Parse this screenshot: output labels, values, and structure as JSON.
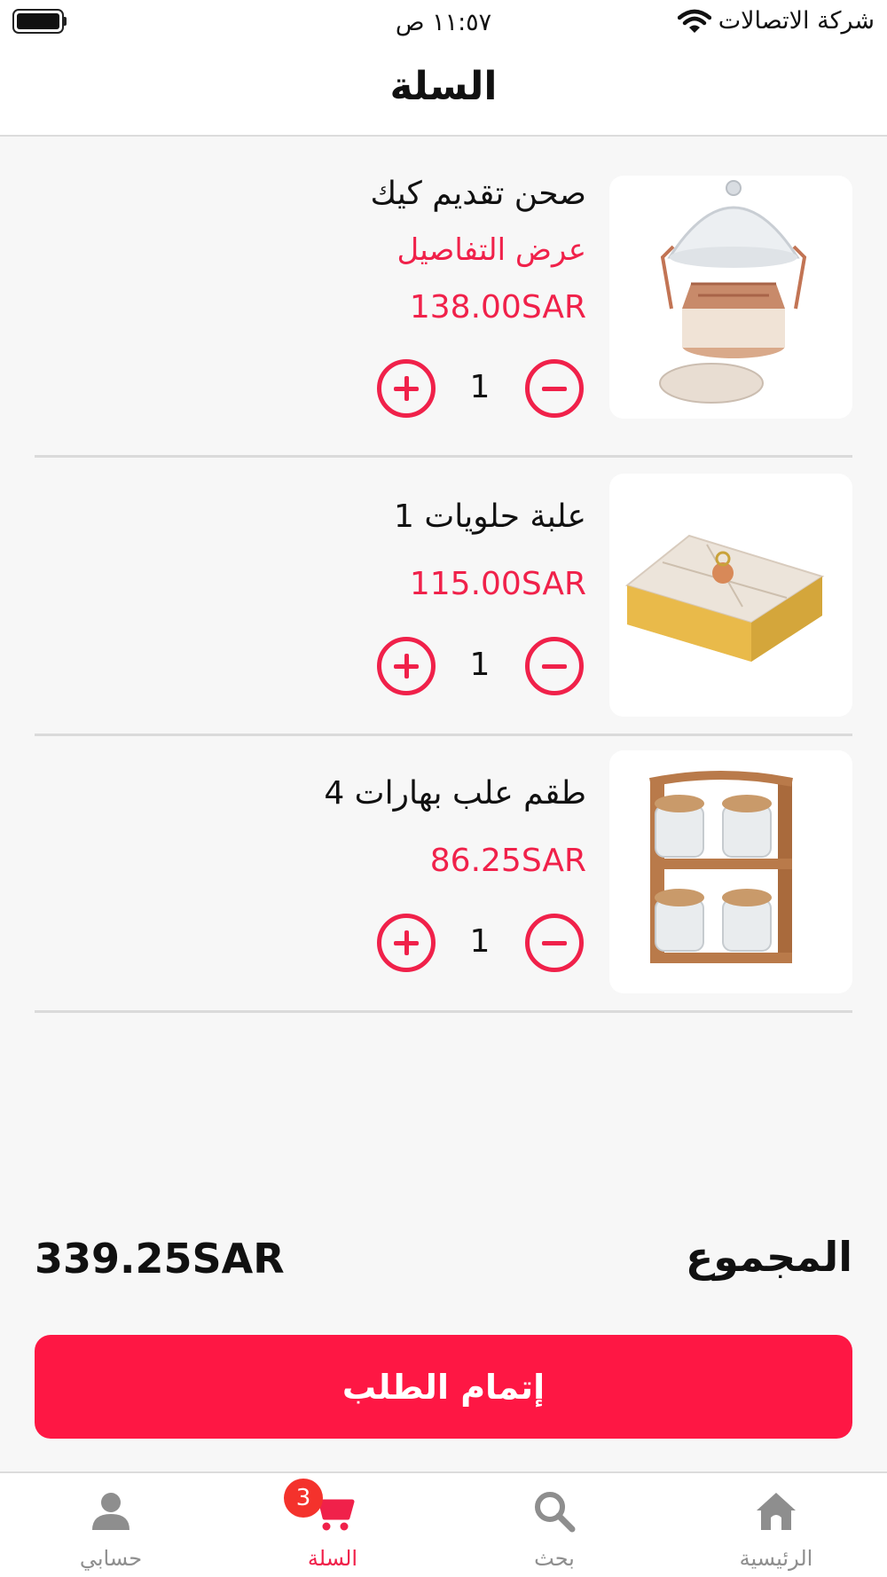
{
  "status_bar": {
    "carrier": "شركة الاتصالات",
    "time": "١١:٥٧ ص"
  },
  "header": {
    "title": "السلة"
  },
  "cart": {
    "items": [
      {
        "name": "صحن تقديم كيك",
        "details_link": "عرض التفاصيل",
        "price": "138.00SAR",
        "quantity": "1",
        "image_icon": "cake-stand-image"
      },
      {
        "name": "علبة حلويات 1",
        "price": "115.00SAR",
        "quantity": "1",
        "image_icon": "sweets-box-image"
      },
      {
        "name": "طقم علب بهارات 4",
        "price": "86.25SAR",
        "quantity": "1",
        "image_icon": "spice-jars-image"
      }
    ]
  },
  "summary": {
    "total_label": "المجموع",
    "total_value": "339.25SAR"
  },
  "checkout": {
    "label": "إتمام الطلب"
  },
  "tab_bar": {
    "tabs": [
      {
        "label": "حسابي",
        "icon": "person-icon",
        "active": false
      },
      {
        "label": "السلة",
        "icon": "cart-icon",
        "active": true,
        "badge": "3"
      },
      {
        "label": "بحث",
        "icon": "search-icon",
        "active": false
      },
      {
        "label": "الرئيسية",
        "icon": "home-icon",
        "active": false
      }
    ]
  },
  "colors": {
    "accent": "#f0214a",
    "button": "#fe1744",
    "badge": "#f4322c",
    "background": "#f7f7f7"
  }
}
